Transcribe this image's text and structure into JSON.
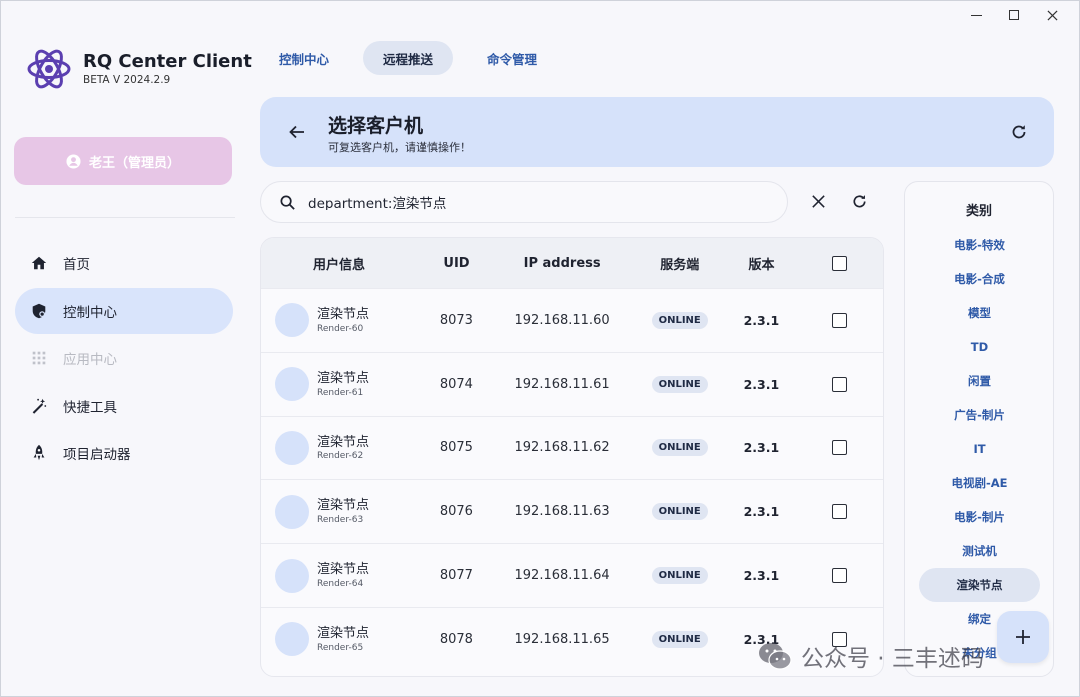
{
  "app": {
    "name_part1": "RQ Center",
    "name_part2": " Client",
    "version": "BETA V 2024.2.9"
  },
  "user": {
    "label": "老王（管理员）"
  },
  "sidebar": {
    "items": [
      {
        "label": "首页",
        "icon": "home-icon"
      },
      {
        "label": "控制中心",
        "icon": "shield-icon",
        "active": true
      },
      {
        "label": "应用中心",
        "icon": "apps-grid-icon",
        "disabled": true
      },
      {
        "label": "快捷工具",
        "icon": "magic-wand-icon"
      },
      {
        "label": "项目启动器",
        "icon": "rocket-icon"
      }
    ]
  },
  "tabs": [
    {
      "label": "控制中心"
    },
    {
      "label": "远程推送",
      "active": true
    },
    {
      "label": "命令管理"
    }
  ],
  "header": {
    "title": "选择客户机",
    "subtitle": "可复选客户机，请谨慎操作！"
  },
  "search": {
    "value": "department:渲染节点"
  },
  "table": {
    "headers": {
      "user": "用户信息",
      "uid": "UID",
      "ip": "IP address",
      "service": "服务端",
      "version": "版本"
    },
    "rows": [
      {
        "name": "渲染节点",
        "host": "Render-60",
        "uid": "8073",
        "ip": "192.168.11.60",
        "status": "ONLINE",
        "version": "2.3.1"
      },
      {
        "name": "渲染节点",
        "host": "Render-61",
        "uid": "8074",
        "ip": "192.168.11.61",
        "status": "ONLINE",
        "version": "2.3.1"
      },
      {
        "name": "渲染节点",
        "host": "Render-62",
        "uid": "8075",
        "ip": "192.168.11.62",
        "status": "ONLINE",
        "version": "2.3.1"
      },
      {
        "name": "渲染节点",
        "host": "Render-63",
        "uid": "8076",
        "ip": "192.168.11.63",
        "status": "ONLINE",
        "version": "2.3.1"
      },
      {
        "name": "渲染节点",
        "host": "Render-64",
        "uid": "8077",
        "ip": "192.168.11.64",
        "status": "ONLINE",
        "version": "2.3.1"
      },
      {
        "name": "渲染节点",
        "host": "Render-65",
        "uid": "8078",
        "ip": "192.168.11.65",
        "status": "ONLINE",
        "version": "2.3.1"
      }
    ]
  },
  "categories": {
    "title": "类别",
    "items": [
      {
        "label": "电影-特效"
      },
      {
        "label": "电影-合成"
      },
      {
        "label": "模型"
      },
      {
        "label": "TD"
      },
      {
        "label": "闲置"
      },
      {
        "label": "广告-制片"
      },
      {
        "label": "IT"
      },
      {
        "label": "电视剧-AE"
      },
      {
        "label": "电影-制片"
      },
      {
        "label": "测试机"
      },
      {
        "label": "渲染节点",
        "active": true
      },
      {
        "label": "绑定"
      },
      {
        "label": "未分组"
      }
    ]
  },
  "watermark": {
    "text": "公众号 · 三丰述码"
  },
  "colors": {
    "accent": "#2f5aa8",
    "header_bg": "#d6e2fa",
    "user_button": "#e7c6e6",
    "active_nav": "#d9e4fb"
  }
}
